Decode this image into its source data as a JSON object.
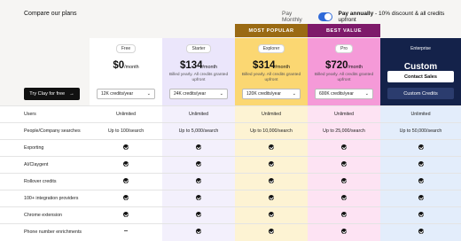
{
  "header": {
    "title": "Compare our plans",
    "toggle_monthly": "Pay Monthly",
    "toggle_annual_bold": "Pay annually",
    "toggle_annual_rest": " - 10% discount & all credits upfront"
  },
  "ribbons": {
    "popular": "MOST POPULAR",
    "best": "BEST VALUE"
  },
  "cta": {
    "try_label": "Try Clay for free",
    "arrow": "→"
  },
  "plans": [
    {
      "name": "Free",
      "price": "$0",
      "per": "/month",
      "billed": "",
      "credits": "12K credits/year"
    },
    {
      "name": "Starter",
      "price": "$134",
      "per": "/month",
      "billed": "Billed yearly. All credits granted upfront",
      "credits": "24K credits/year"
    },
    {
      "name": "Explorer",
      "price": "$314",
      "per": "/month",
      "billed": "Billed yearly. All credits granted upfront",
      "credits": "120K credits/year"
    },
    {
      "name": "Pro",
      "price": "$720",
      "per": "/month",
      "billed": "Billed yearly. All credits granted upfront",
      "credits": "600K credits/year"
    }
  ],
  "enterprise": {
    "name": "Enterprise",
    "price": "Custom",
    "contact": "Contact Sales",
    "credits": "Custom Credits"
  },
  "features": [
    {
      "label": "Users",
      "values": [
        "Unlimited",
        "Unlimited",
        "Unlimited",
        "Unlimited",
        "Unlimited"
      ]
    },
    {
      "label": "People/Company searches",
      "values": [
        "Up to 100/search",
        "Up to 5,000/search",
        "Up to 10,000/search",
        "Up to 25,000/search",
        "Up to 50,000/search"
      ]
    },
    {
      "label": "Exporting",
      "values": [
        "check",
        "check",
        "check",
        "check",
        "check"
      ]
    },
    {
      "label": "AI/Claygent",
      "values": [
        "check",
        "check",
        "check",
        "check",
        "check"
      ]
    },
    {
      "label": "Rollover credits",
      "values": [
        "check",
        "check",
        "check",
        "check",
        "check"
      ]
    },
    {
      "label": "100+ integration providers",
      "values": [
        "check",
        "check",
        "check",
        "check",
        "check"
      ]
    },
    {
      "label": "Chrome extension",
      "values": [
        "check",
        "check",
        "check",
        "check",
        "check"
      ]
    },
    {
      "label": "Phone number enrichments",
      "values": [
        "dash",
        "check",
        "check",
        "check",
        "check"
      ]
    }
  ],
  "colors": {
    "toggle": "#2f6ad8",
    "popular_ribbon": "#9a6a13",
    "best_ribbon": "#7e1a6a",
    "starter": "#ebe6fb",
    "explorer": "#fbd772",
    "pro": "#f59ad8",
    "enterprise": "#14224a"
  }
}
